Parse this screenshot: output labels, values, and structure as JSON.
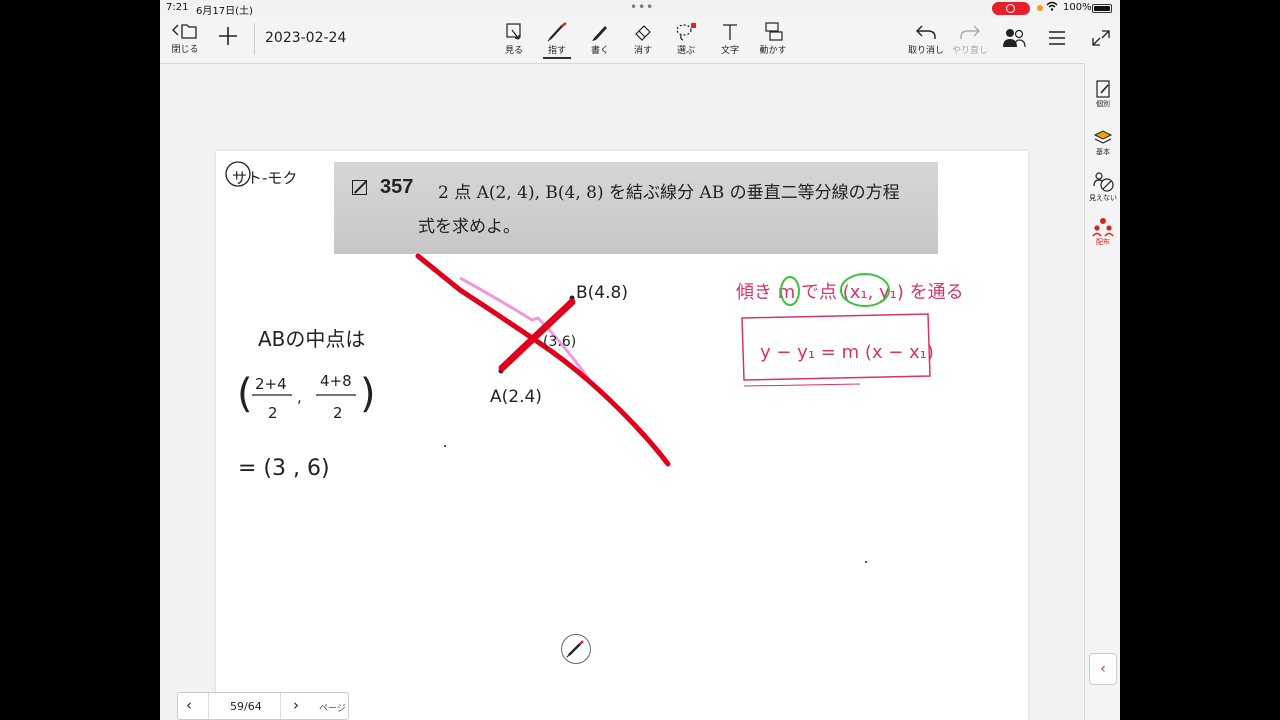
{
  "status_bar": {
    "time": "7:21",
    "date": "6月17日(土)",
    "battery": "100%"
  },
  "toolbar": {
    "close_label": "閉じる",
    "document_title": "2023-02-24",
    "tools": [
      {
        "label": "見る",
        "icon": "view-icon"
      },
      {
        "label": "指す",
        "icon": "laser-pointer-icon"
      },
      {
        "label": "書く",
        "icon": "pen-icon"
      },
      {
        "label": "消す",
        "icon": "eraser-icon"
      },
      {
        "label": "選ぶ",
        "icon": "lasso-select-icon"
      },
      {
        "label": "文字",
        "icon": "text-icon"
      },
      {
        "label": "動かす",
        "icon": "move-icon"
      }
    ],
    "active_tool": "指す",
    "undo_label": "取り消し",
    "redo_label": "やり直し"
  },
  "sidebar": {
    "items": [
      {
        "label": "個別",
        "icon": "individual-note-icon"
      },
      {
        "label": "基本",
        "icon": "layers-icon"
      },
      {
        "label": "見えない",
        "icon": "hidden-icon"
      },
      {
        "label": "配布",
        "icon": "distribute-icon"
      }
    ]
  },
  "problem": {
    "number": "357",
    "line1": "2 点 A(2,  4), B(4,  8) を結ぶ線分 AB の垂直二等分線の方程",
    "line2": "式を求めよ。"
  },
  "handwriting": {
    "header_note": "サト-モク",
    "midpoint_label": "ABの中点は",
    "midpoint_frac_x_num": "2+4",
    "midpoint_frac_x_den": "2",
    "midpoint_frac_y_num": "4+8",
    "midpoint_frac_y_den": "2",
    "midpoint_result": "= (3 , 6)",
    "point_b": "B(4.8)",
    "point_a": "A(2.4)",
    "point_mid": "(3.6)",
    "slope_note": "傾き m で点 (x₁, y₁) を通る",
    "formula": "y − y₁ = m (x − x₁)"
  },
  "page_nav": {
    "current": "59/64",
    "unit": "ページ"
  },
  "colors": {
    "ink_black": "#222222",
    "ink_red": "#e0001a",
    "ink_pink": "#ee99dd",
    "ink_magenta": "#d6336c",
    "ink_green": "#3cc43c",
    "accent_red": "#e5202a"
  }
}
